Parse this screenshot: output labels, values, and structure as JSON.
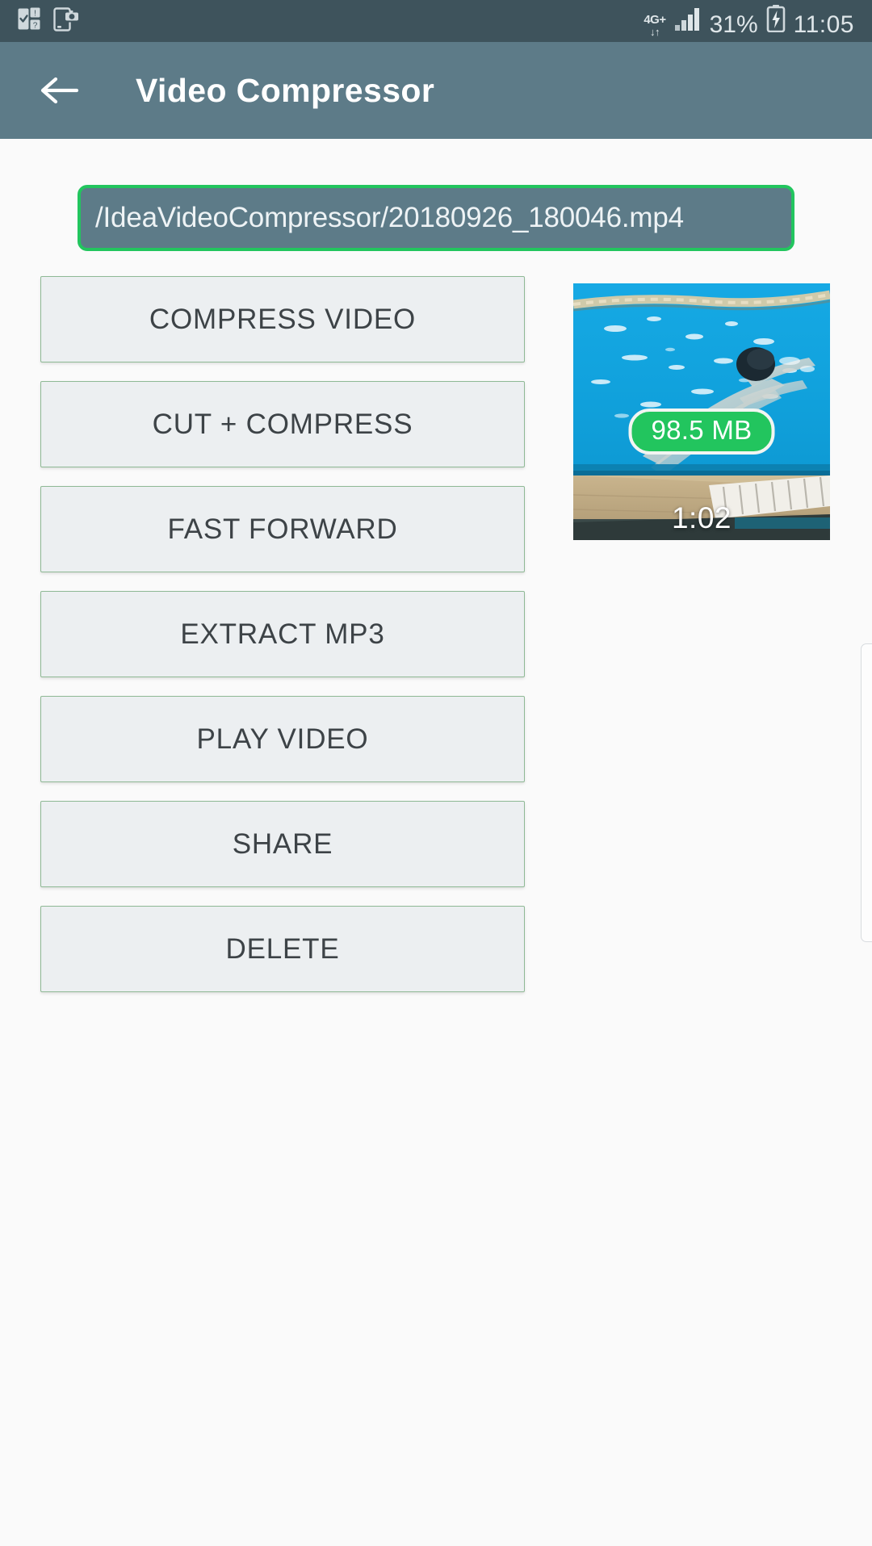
{
  "status_bar": {
    "notification_icons": [
      "quiz-notification-icon",
      "screenshot-capture-icon"
    ],
    "network_type": "4G+",
    "data_arrows": "↓↑",
    "signal_icon": "signal-bars-icon",
    "battery_percent": "31%",
    "battery_icon": "battery-charging-icon",
    "clock": "11:05"
  },
  "app_bar": {
    "back_icon": "back-arrow-icon",
    "title": "Video Compressor"
  },
  "file_path": {
    "value": "/IdeaVideoCompressor/20180926_180046.mp4"
  },
  "actions": [
    {
      "label": "COMPRESS VIDEO",
      "name": "compress-video-button"
    },
    {
      "label": "CUT + COMPRESS",
      "name": "cut-compress-button"
    },
    {
      "label": "FAST FORWARD",
      "name": "fast-forward-button"
    },
    {
      "label": "EXTRACT MP3",
      "name": "extract-mp3-button"
    },
    {
      "label": "PLAY VIDEO",
      "name": "play-video-button"
    },
    {
      "label": "SHARE",
      "name": "share-button"
    },
    {
      "label": "DELETE",
      "name": "delete-button"
    }
  ],
  "video": {
    "size_badge": "98.5 MB",
    "duration": "1:02",
    "thumbnail_description": "swimmer-in-pool-thumbnail"
  },
  "colors": {
    "status_bar": "#3e535c",
    "app_bar": "#5d7b88",
    "accent_green": "#22c55e",
    "button_face": "#eceff1",
    "button_border": "#8fb995",
    "page_background": "#fafafa",
    "text_dark": "#3d4347"
  }
}
